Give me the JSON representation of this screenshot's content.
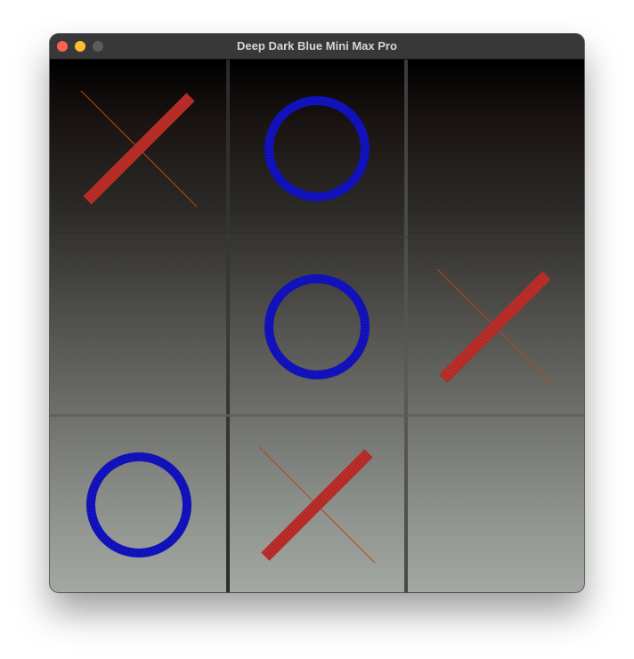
{
  "window": {
    "title": "Deep Dark Blue Mini Max Pro"
  },
  "board": {
    "cells": [
      {
        "row": 0,
        "col": 0,
        "mark": "X"
      },
      {
        "row": 0,
        "col": 1,
        "mark": "O"
      },
      {
        "row": 0,
        "col": 2,
        "mark": ""
      },
      {
        "row": 1,
        "col": 0,
        "mark": ""
      },
      {
        "row": 1,
        "col": 1,
        "mark": "O"
      },
      {
        "row": 1,
        "col": 2,
        "mark": "X"
      },
      {
        "row": 2,
        "col": 0,
        "mark": "O"
      },
      {
        "row": 2,
        "col": 1,
        "mark": "X"
      },
      {
        "row": 2,
        "col": 2,
        "mark": ""
      }
    ]
  },
  "colors": {
    "x_color": "#c0312c",
    "x_thin_color": "#b8461a",
    "o_color": "#1414c8",
    "grid_line_color": "#555555"
  }
}
